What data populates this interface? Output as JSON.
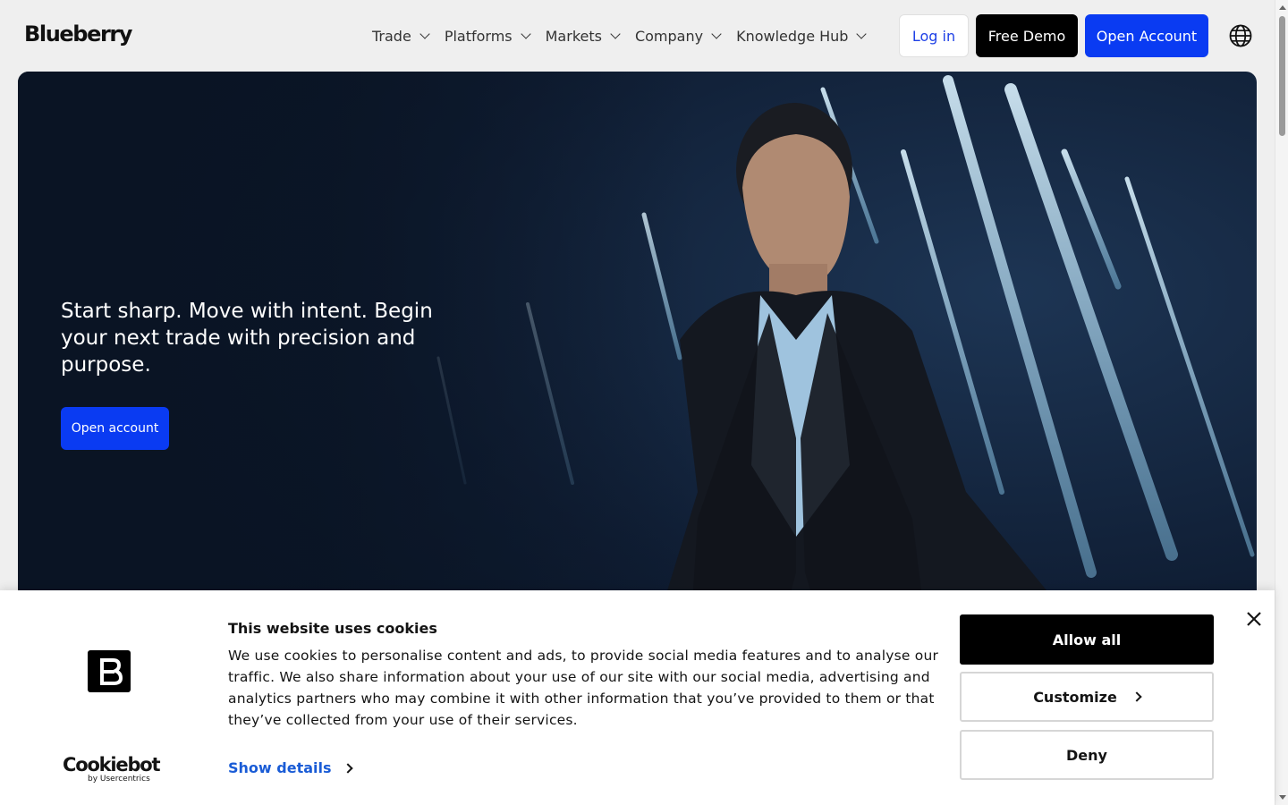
{
  "header": {
    "logo": "Blueberry",
    "nav": [
      {
        "label": "Trade"
      },
      {
        "label": "Platforms"
      },
      {
        "label": "Markets"
      },
      {
        "label": "Company"
      },
      {
        "label": "Knowledge Hub"
      }
    ],
    "login_label": "Log in",
    "demo_label": "Free Demo",
    "open_account_label": "Open Account",
    "language_icon": "globe-icon"
  },
  "hero": {
    "headline": "Start sharp. Move with intent. Begin your next trade with precision and purpose.",
    "cta_label": "Open account"
  },
  "cookie_banner": {
    "title": "This website uses cookies",
    "body": "We use cookies to personalise content and ads, to provide social media features and to analyse our traffic. We also share information about your use of our site with our social media, advertising and analytics partners who may combine it with other information that you’ve provided to them or that they’ve collected from your use of their services.",
    "show_details_label": "Show details",
    "allow_all_label": "Allow all",
    "customize_label": "Customize",
    "deny_label": "Deny",
    "brand_name": "Cookiebot",
    "brand_sub": "by Usercentrics",
    "close_icon": "close-icon"
  },
  "colors": {
    "brand_blue": "#0a3bf2",
    "login_text": "#1f41e6",
    "link_blue": "#1a5cd6",
    "hero_dark": "#0f1d33"
  }
}
